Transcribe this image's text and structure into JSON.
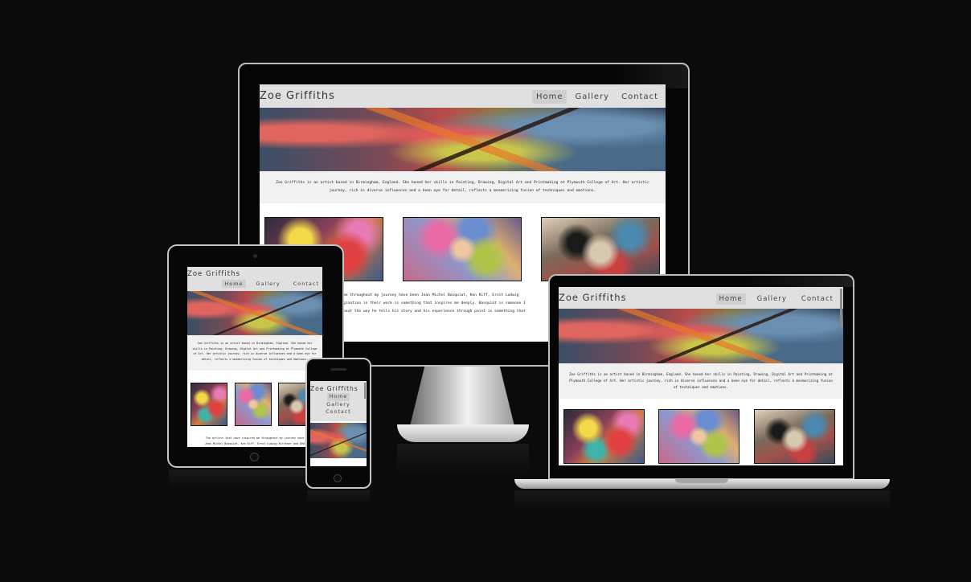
{
  "site": {
    "title": "Zoe Griffiths",
    "nav": [
      {
        "label": "Home",
        "active": true
      },
      {
        "label": "Gallery",
        "active": false
      },
      {
        "label": "Contact",
        "active": false
      }
    ],
    "intro": "Zoe Griffiths is an artist based in Birmingham, England. She honed her skills in Painting, Drawing, Digital Art and Printmaking at Plymouth College of Art. Her artistic journey, rich in diverse influences and a keen eye for detail, reflects a mesmerizing fusion of techniques and emotions.",
    "influences_monitor": [
      "me throughout my journey have been Jean Michel Basquiat, Ken Kiff, Ernst Ludwig",
      "gination in their work is something that inspires me deeply. Basquiat is someone I",
      "bout the way he tells his story and his experience through paint is something that"
    ],
    "influences_tablet": [
      "The artists that have inspired me throughout my journey have",
      "Jean Michel Basquiat, Ken Kiff, Ernst Ludwig Kirchner and Ded"
    ]
  },
  "colors": {
    "backdrop": "#0c0b0c",
    "header": "#e0e0e0",
    "nav_active": "#cfcfcf",
    "intro_bg": "#f1f1f1"
  }
}
